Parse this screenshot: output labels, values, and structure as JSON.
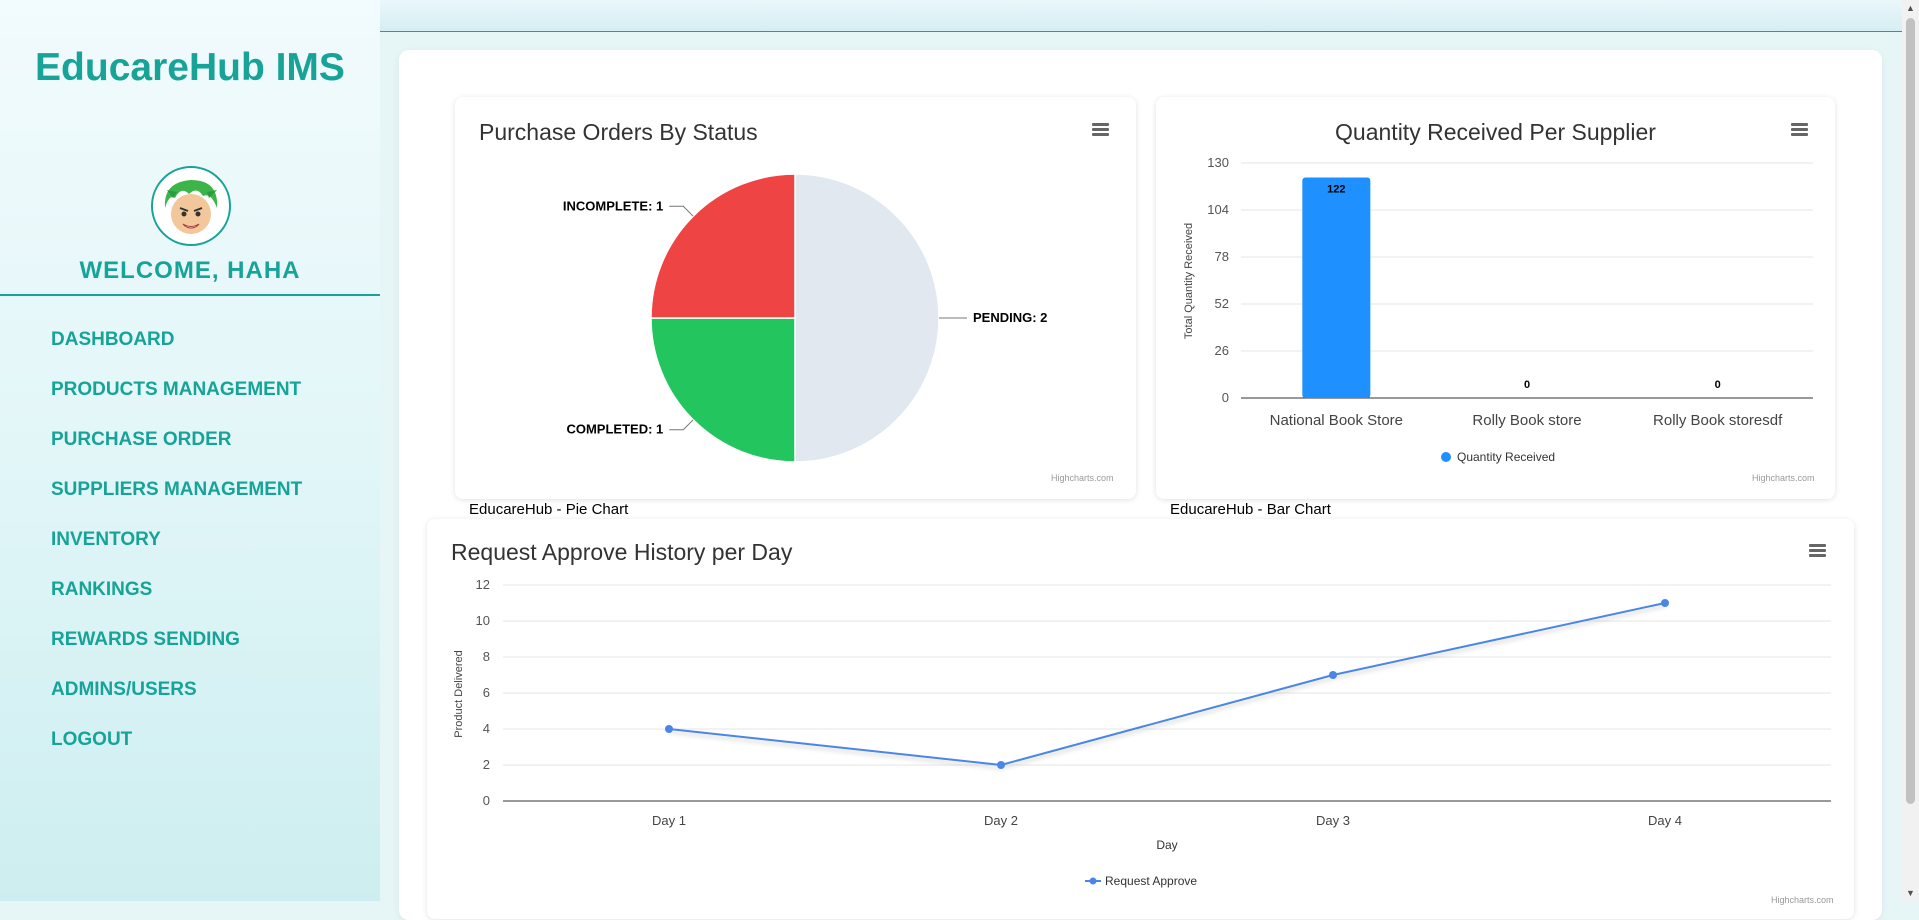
{
  "sidebar": {
    "brand": "EducareHub IMS",
    "welcome": "WELCOME, HAHA",
    "nav": [
      {
        "label": "DASHBOARD"
      },
      {
        "label": "PRODUCTS MANAGEMENT"
      },
      {
        "label": "PURCHASE ORDER"
      },
      {
        "label": "SUPPLIERS MANAGEMENT"
      },
      {
        "label": "INVENTORY"
      },
      {
        "label": "RANKINGS"
      },
      {
        "label": "REWARDS SENDING"
      },
      {
        "label": "ADMINS/USERS"
      },
      {
        "label": "LOGOUT"
      }
    ]
  },
  "icons": {
    "menu": "hamburger-menu-icon",
    "avatar": "user-avatar-icon"
  },
  "colors": {
    "accent": "#17a398",
    "pie_incomplete": "#ef4444",
    "pie_completed": "#22c55e",
    "pie_pending": "#e2e8f0",
    "bar": "#1e90ff",
    "line": "#4a86e8"
  },
  "credits": "Highcharts.com",
  "captions": {
    "pie": "EducareHub - Pie Chart",
    "bar": "EducareHub - Bar Chart"
  },
  "chart_data": [
    {
      "type": "pie",
      "title": "Purchase Orders By Status",
      "slices": [
        {
          "name": "PENDING",
          "value": 2,
          "label": "PENDING: 2"
        },
        {
          "name": "COMPLETED",
          "value": 1,
          "label": "COMPLETED: 1"
        },
        {
          "name": "INCOMPLETE",
          "value": 1,
          "label": "INCOMPLETE: 1"
        }
      ]
    },
    {
      "type": "bar",
      "title": "Quantity Received Per Supplier",
      "categories": [
        "National Book Store",
        "Rolly Book store",
        "Rolly Book storesdf"
      ],
      "series": [
        {
          "name": "Quantity Received",
          "values": [
            122,
            0,
            0
          ]
        }
      ],
      "ylabel": "Total Quantity Received",
      "ylim": [
        0,
        130
      ],
      "yticks": [
        "0",
        "26",
        "52",
        "78",
        "104",
        "130"
      ],
      "grid": true,
      "legend": "bottom"
    },
    {
      "type": "line",
      "title": "Request Approve History per Day",
      "categories": [
        "Day 1",
        "Day 2",
        "Day 3",
        "Day 4"
      ],
      "series": [
        {
          "name": "Request Approve",
          "values": [
            4,
            2,
            7,
            11
          ]
        }
      ],
      "xlabel": "Day",
      "ylabel": "Product Delivered",
      "ylim": [
        0,
        12
      ],
      "yticks": [
        "0",
        "2",
        "4",
        "6",
        "8",
        "10",
        "12"
      ],
      "grid": true,
      "legend": "bottom"
    }
  ]
}
